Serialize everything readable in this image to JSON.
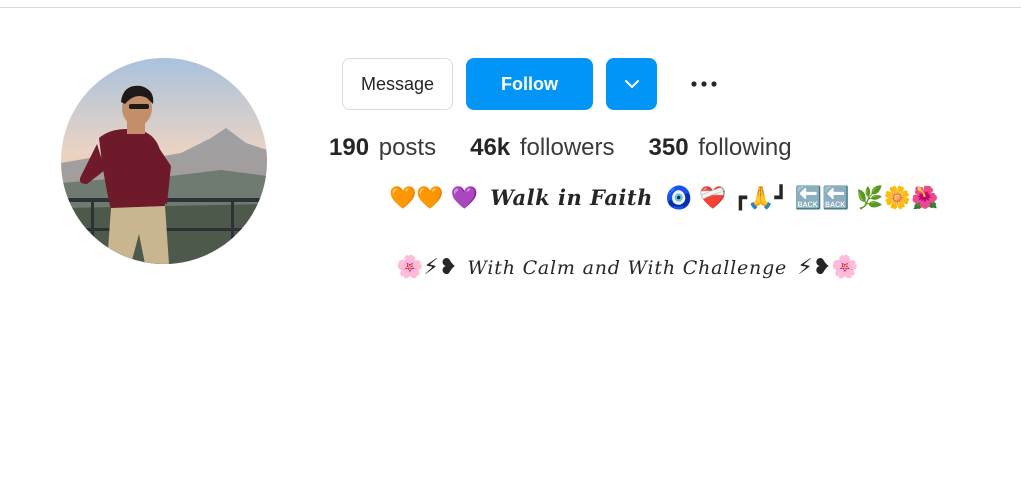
{
  "profile": {
    "avatar_icon": "profile-photo"
  },
  "actions": {
    "message_label": "Message",
    "follow_label": "Follow",
    "dropdown_icon": "chevron-down-icon",
    "more_icon": "more-icon"
  },
  "stats": [
    {
      "number": "190",
      "label": "posts"
    },
    {
      "number": "46k",
      "label": "followers"
    },
    {
      "number": "350",
      "label": "following"
    }
  ],
  "bio": {
    "line1_prefix": "🧡🧡 💜",
    "line1_text": "Walk in Faith",
    "line1_suffix": "🧿 ❤️‍🩹 ┏🙏┛ 🔙🔙 🌿🌼🌺",
    "line2_prefix": "🌸⚡❥",
    "line2_text": "With Calm and With Challenge",
    "line2_suffix": "⚡❥🌸"
  },
  "colors": {
    "accent": "#0095f6",
    "border": "#dbdbdb",
    "text": "#262626"
  }
}
